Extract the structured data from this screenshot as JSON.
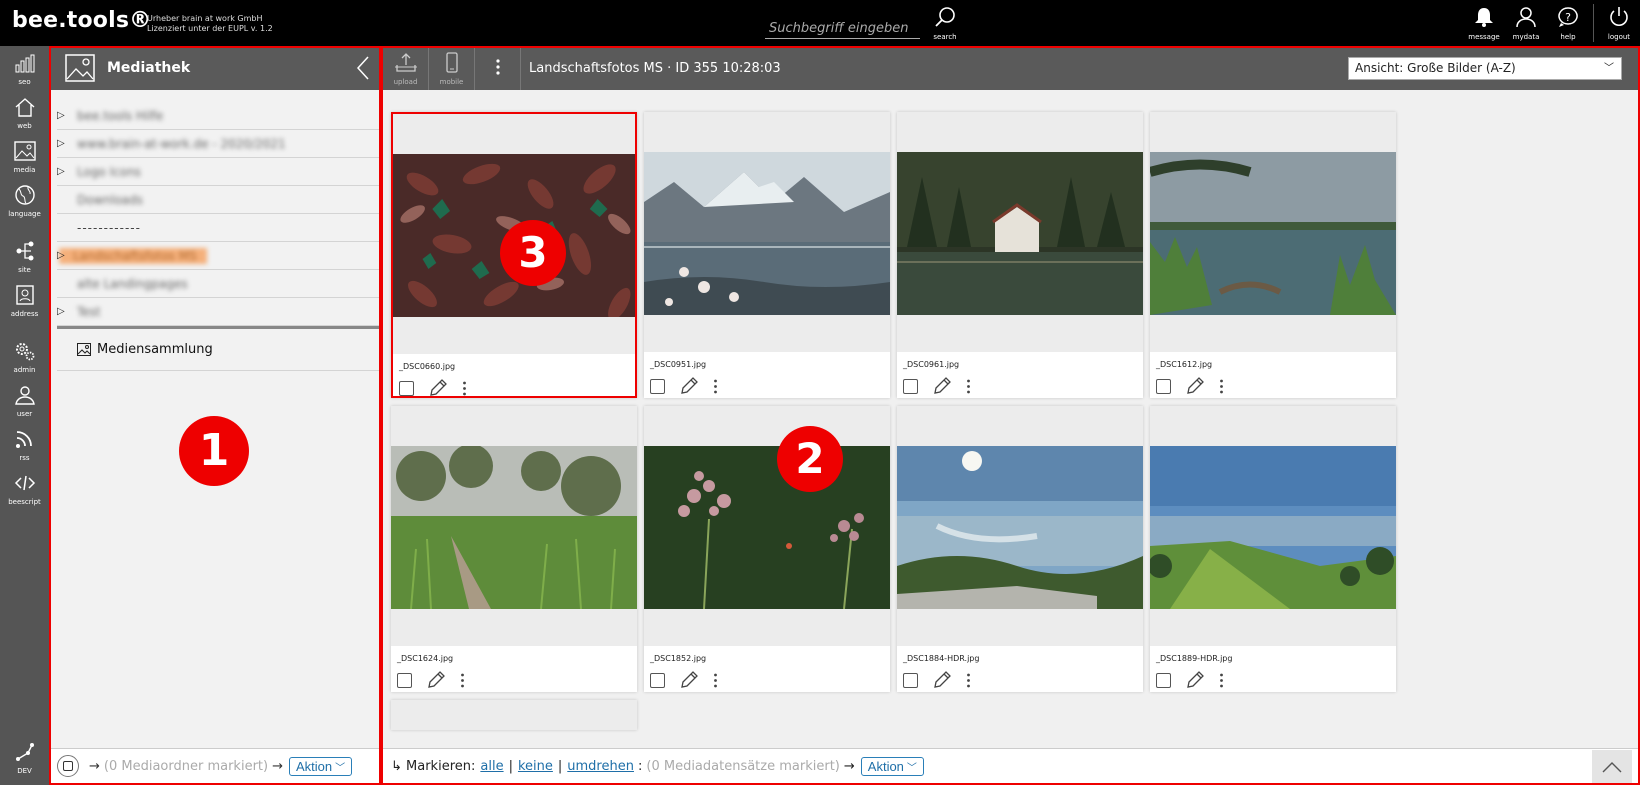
{
  "topbar": {
    "logo": "bee.tools®",
    "sub_line1": "Urheber brain at work GmbH",
    "sub_line2": "Lizenziert unter der EUPL v. 1.2",
    "search_placeholder": "Suchbegriff eingeben",
    "search_label": "search",
    "icons": [
      {
        "name": "bell-icon",
        "label": "message"
      },
      {
        "name": "user-icon",
        "label": "mydata"
      },
      {
        "name": "help-icon",
        "label": "help"
      },
      {
        "name": "power-icon",
        "label": "logout"
      }
    ]
  },
  "nav": {
    "items": [
      {
        "icon": "chart-icon",
        "label": "seo"
      },
      {
        "icon": "home-icon",
        "label": "web"
      },
      {
        "icon": "image-icon",
        "label": "media"
      },
      {
        "icon": "globe-icon",
        "label": "language"
      },
      {
        "icon": "sitemap-icon",
        "label": "site"
      },
      {
        "icon": "contact-icon",
        "label": "address"
      },
      {
        "icon": "cog-icon",
        "label": "admin"
      },
      {
        "icon": "user-group-icon",
        "label": "user"
      },
      {
        "icon": "rss-icon",
        "label": "rss"
      },
      {
        "icon": "code-icon",
        "label": "beescript"
      }
    ],
    "dev_label": "DEV"
  },
  "folder_panel": {
    "title": "Mediathek",
    "tree": [
      {
        "label": "bee.tools Hilfe",
        "has_children": true,
        "active": false,
        "blurred": true
      },
      {
        "label": "www.brain-at-work.de - 2020/2021",
        "has_children": true,
        "active": false,
        "blurred": true
      },
      {
        "label": "Logo Icons",
        "has_children": true,
        "active": false,
        "blurred": true
      },
      {
        "label": "Downloads",
        "has_children": false,
        "active": false,
        "blurred": true
      },
      {
        "label": "------------",
        "has_children": false,
        "active": false,
        "blurred": false
      },
      {
        "label": "Landschaftsfotos MS",
        "has_children": true,
        "active": true,
        "blurred": true
      },
      {
        "label": "alte Landingpages",
        "has_children": false,
        "active": false,
        "blurred": true
      },
      {
        "label": "Test",
        "has_children": true,
        "active": false,
        "blurred": true
      }
    ],
    "collection_label": "Mediensammlung",
    "marker": "1",
    "footer": {
      "arrow": "→",
      "marked_text": "(0 Mediaordner markiert)",
      "arrow2": "→",
      "action_label": "Aktion"
    }
  },
  "main": {
    "toolbar": {
      "upload_label": "upload",
      "mobile_label": "mobile",
      "title": "Landschaftsfotos MS · ID 355 10:28:03",
      "view_select": "Ansicht: Große Bilder (A-Z)"
    },
    "cards": [
      {
        "file": "_DSC0660.jpg",
        "selected": true
      },
      {
        "file": "_DSC0951.jpg",
        "selected": false
      },
      {
        "file": "_DSC0961.jpg",
        "selected": false
      },
      {
        "file": "_DSC1612.jpg",
        "selected": false
      },
      {
        "file": "_DSC1624.jpg",
        "selected": false
      },
      {
        "file": "_DSC1852.jpg",
        "selected": false
      },
      {
        "file": "_DSC1884-HDR.jpg",
        "selected": false
      },
      {
        "file": "_DSC1889-HDR.jpg",
        "selected": false
      }
    ],
    "markers": [
      "2",
      "3"
    ],
    "footer": {
      "prefix": "↳ Markieren:",
      "all": "alle",
      "none": "keine",
      "invert": "umdrehen",
      "sep": "|",
      "colon": ":",
      "marked_text": "(0 Mediadatensätze markiert)",
      "arrow": "→",
      "action_label": "Aktion"
    }
  },
  "colors": {
    "accent_red": "#e00000",
    "link_blue": "#1f6fa8",
    "active_folder": "#f5b07b"
  }
}
